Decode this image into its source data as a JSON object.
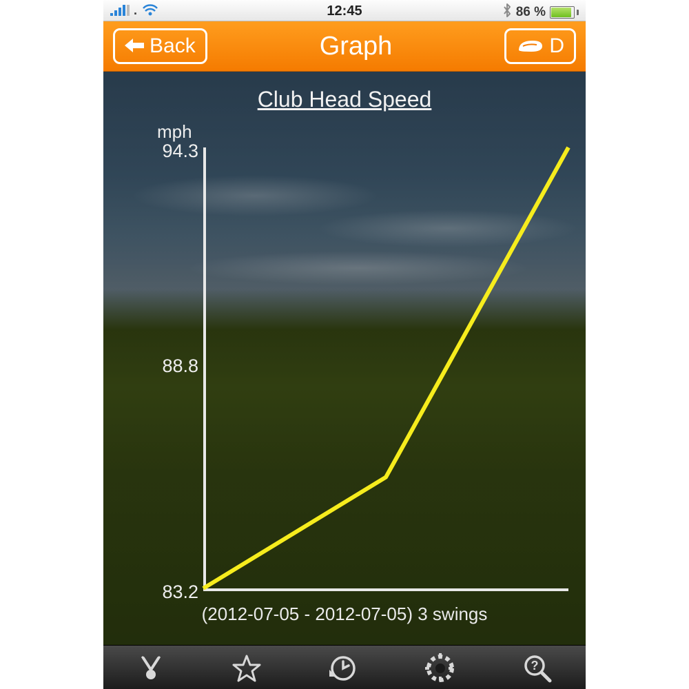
{
  "status": {
    "time": "12:45",
    "battery_pct": "86 %",
    "bluetooth_icon": "✱"
  },
  "nav": {
    "back_label": "Back",
    "title": "Graph",
    "club_label": "D"
  },
  "chart_data": {
    "type": "line",
    "title": "Club Head Speed",
    "ylabel": "mph",
    "xlabel": "",
    "ylim": [
      83.2,
      94.3
    ],
    "y_ticks": [
      94.3,
      88.8,
      83.2
    ],
    "x": [
      1,
      2,
      3
    ],
    "values": [
      83.2,
      86.0,
      94.3
    ],
    "date_range": "(2012-07-05 - 2012-07-05) 3 swings"
  },
  "tabs": {
    "items": [
      "swings-icon",
      "star-icon",
      "history-icon",
      "gear-icon",
      "help-icon"
    ]
  }
}
